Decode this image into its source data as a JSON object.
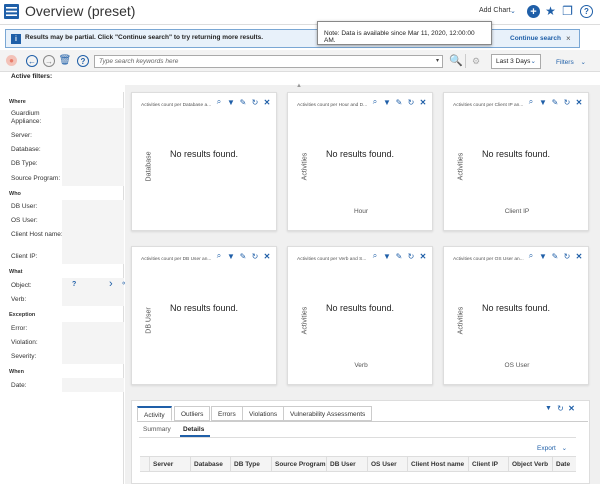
{
  "header": {
    "title": "Overview (preset)",
    "add_chart": "Add Chart",
    "chevron": "⌄",
    "plus": "+",
    "star": "★",
    "copy": "❐",
    "help": "?"
  },
  "banner": {
    "info": "i",
    "text": "Results may be partial. Click \"Continue search\" to try returning more results.",
    "continue": "Continue search",
    "close": "×"
  },
  "note": {
    "text": "Note: Data is available since Mar 11, 2020, 12:00:00 AM."
  },
  "toolbar": {
    "record": "●",
    "back": "←",
    "forward": "→",
    "trash": "🗑",
    "help": "?",
    "search_placeholder": "Type search keywords here",
    "dropdown": "▾",
    "search_icon": "🔍",
    "settings": "⚙",
    "date_range": "Last 3 Days",
    "date_chev": "⌄",
    "filters": "Filters",
    "filters_chev": "⌄"
  },
  "active_filters": "Active filters:",
  "sidebar": {
    "where": "Where",
    "guardium": "Guardium Appliance:",
    "server": "Server:",
    "database": "Database:",
    "dbtype": "DB Type:",
    "source": "Source Program:",
    "who": "Who",
    "dbuser": "DB User:",
    "osuser": "OS User:",
    "clienthost": "Client Host name:",
    "clientip": "Client IP:",
    "what": "What",
    "object": "Object:",
    "object_q": "?",
    "object_arrow": "›",
    "verb": "Verb:",
    "exception": "Exception",
    "error": "Error:",
    "violation": "Violation:",
    "severity": "Severity:",
    "when": "When",
    "date": "Date:"
  },
  "widgets": [
    {
      "title": "Activities count per Database a...",
      "ylabel": "Database",
      "xlabel": "",
      "noresult": "No results found."
    },
    {
      "title": "Activities count per Hour and D...",
      "ylabel": "Activities",
      "xlabel": "Hour",
      "noresult": "No results found."
    },
    {
      "title": "Activities count per Client IP an...",
      "ylabel": "Activities",
      "xlabel": "Client IP",
      "noresult": "No results found."
    },
    {
      "title": "Activities count per DB User an...",
      "ylabel": "DB User",
      "xlabel": "",
      "noresult": "No results found."
    },
    {
      "title": "Activities count per Verb and S...",
      "ylabel": "Activities",
      "xlabel": "Verb",
      "noresult": "No results found."
    },
    {
      "title": "Activities count per OS User an...",
      "ylabel": "Activities",
      "xlabel": "OS User",
      "noresult": "No results found."
    }
  ],
  "widget_icons": {
    "zoom": "⌕",
    "filter": "▼",
    "wrench": "✎",
    "refresh": "↻",
    "close": "✕"
  },
  "bottom": {
    "tabs": [
      "Activity",
      "Outliers",
      "Errors",
      "Violations",
      "Vulnerability Assessments"
    ],
    "subtabs": [
      "Summary",
      "Details"
    ],
    "export": "Export",
    "columns": [
      "Server",
      "Database",
      "DB Type",
      "Source Program",
      "DB User",
      "OS User",
      "Client Host name",
      "Client IP",
      "Object Verb",
      "Date"
    ]
  },
  "colors": {
    "accent": "#1f5fa8",
    "banner_bg": "#e8f1fa"
  }
}
